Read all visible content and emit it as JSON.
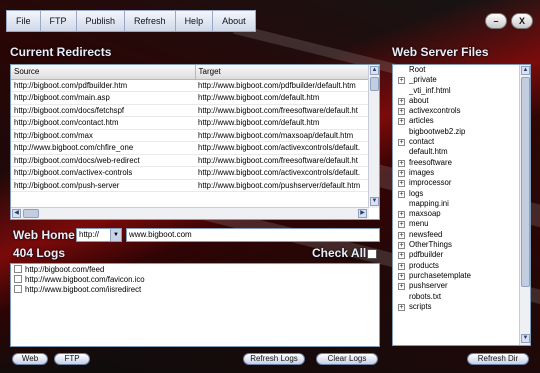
{
  "menu": [
    "File",
    "FTP",
    "Publish",
    "Refresh",
    "Help",
    "About"
  ],
  "window_buttons": {
    "minimize": "–",
    "close": "X"
  },
  "redirects": {
    "title": "Current Redirects",
    "columns": [
      "Source",
      "Target"
    ],
    "rows": [
      [
        "http://bigboot.com/pdfbuilder.htm",
        "http://www.bigboot.com/pdfbuilder/default.htm"
      ],
      [
        "http://bigboot.com/main.asp",
        "http://www.bigboot.com/default.htm"
      ],
      [
        "http://bigboot.com/docs/fetchspf",
        "http://www.bigboot.com/freesoftware/default.ht"
      ],
      [
        "http://bigboot.com/contact.htm",
        "http://www.bigboot.com/default.htm"
      ],
      [
        "http://bigboot.com/max",
        "http://www.bigboot.com/maxsoap/default.htm"
      ],
      [
        "http://www.bigboot.com/chfire_one",
        "http://www.bigboot.com/activexcontrols/default."
      ],
      [
        "http://bigboot.com/docs/web-redirect",
        "http://www.bigboot.com/freesoftware/default.ht"
      ],
      [
        "http://bigboot.com/activex-controls",
        "http://www.bigboot.com/activexcontrols/default."
      ],
      [
        "http://bigboot.com/push-server",
        "http://www.bigboot.com/pushserver/default.htm"
      ]
    ]
  },
  "web_home": {
    "label": "Web Home",
    "protocol": "http://",
    "url": "www.bigboot.com"
  },
  "logs": {
    "title": "404 Logs",
    "check_all": "Check All",
    "items": [
      "http://bigboot.com/feed",
      "http://www.bigboot.com/favicon.ico",
      "http://www.bigboot.com/iisredirect"
    ]
  },
  "server_files": {
    "title": "Web Server Files",
    "items": [
      {
        "label": "Root",
        "expandable": false
      },
      {
        "label": "_private",
        "expandable": true
      },
      {
        "label": "_vti_inf.html",
        "expandable": false
      },
      {
        "label": "about",
        "expandable": true
      },
      {
        "label": "activexcontrols",
        "expandable": true
      },
      {
        "label": "articles",
        "expandable": true
      },
      {
        "label": "bigbootweb2.zip",
        "expandable": false
      },
      {
        "label": "contact",
        "expandable": true
      },
      {
        "label": "default.htm",
        "expandable": false
      },
      {
        "label": "freesoftware",
        "expandable": true
      },
      {
        "label": "images",
        "expandable": true
      },
      {
        "label": "improcessor",
        "expandable": true
      },
      {
        "label": "logs",
        "expandable": true
      },
      {
        "label": "mapping.ini",
        "expandable": false
      },
      {
        "label": "maxsoap",
        "expandable": true
      },
      {
        "label": "menu",
        "expandable": true
      },
      {
        "label": "newsfeed",
        "expandable": true
      },
      {
        "label": "OtherThings",
        "expandable": true
      },
      {
        "label": "pdfbuilder",
        "expandable": true
      },
      {
        "label": "products",
        "expandable": true
      },
      {
        "label": "purchasetemplate",
        "expandable": true
      },
      {
        "label": "pushserver",
        "expandable": true
      },
      {
        "label": "robots.txt",
        "expandable": false
      },
      {
        "label": "scripts",
        "expandable": true
      }
    ]
  },
  "buttons": {
    "web": "Web",
    "ftp": "FTP",
    "refresh_logs": "Refresh Logs",
    "clear_logs": "Clear Logs",
    "refresh_dir": "Refresh Dir"
  }
}
